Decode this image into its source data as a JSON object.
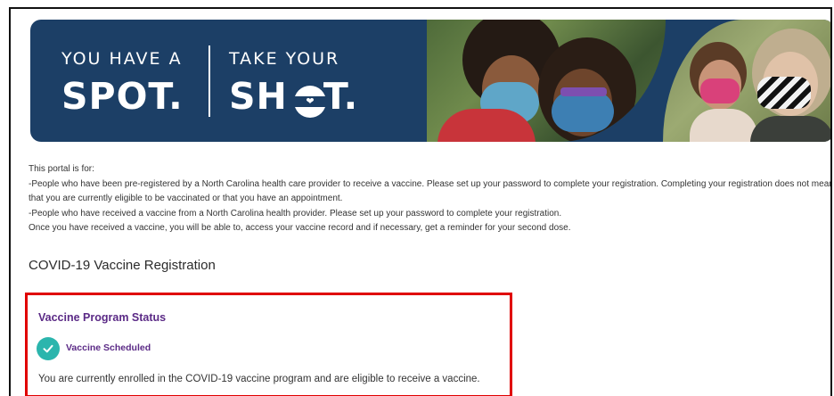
{
  "banner": {
    "line1": "YOU HAVE A",
    "line2": "SPOT.",
    "line3": "TAKE YOUR",
    "line4_start": "SH",
    "line4_end": "T.",
    "colors": {
      "navy": "#1c3f66",
      "white": "#ffffff"
    }
  },
  "portal_info": {
    "lines": [
      "This portal is for:",
      "-People who have been pre-registered by a North Carolina health care provider to receive a vaccine. Please set up your password to complete your registration. Completing your registration does not mean that you are currently eligible to be vaccinated or that you have an appointment.",
      "-People who have received a vaccine from a North Carolina health provider. Please set up your password to complete your registration.",
      "Once you have received a vaccine, you will be able to, access your vaccine record and if necessary, get a reminder for your second dose."
    ]
  },
  "page_title": "COVID-19 Vaccine Registration",
  "status": {
    "title": "Vaccine Program Status",
    "label": "Vaccine Scheduled",
    "icon": "check-circle-icon",
    "description": "You are currently enrolled in the COVID-19 vaccine program and are eligible to receive a vaccine.",
    "colors": {
      "title": "#5b2a86",
      "check": "#2bb5ad",
      "highlight_border": "#e00000"
    }
  }
}
